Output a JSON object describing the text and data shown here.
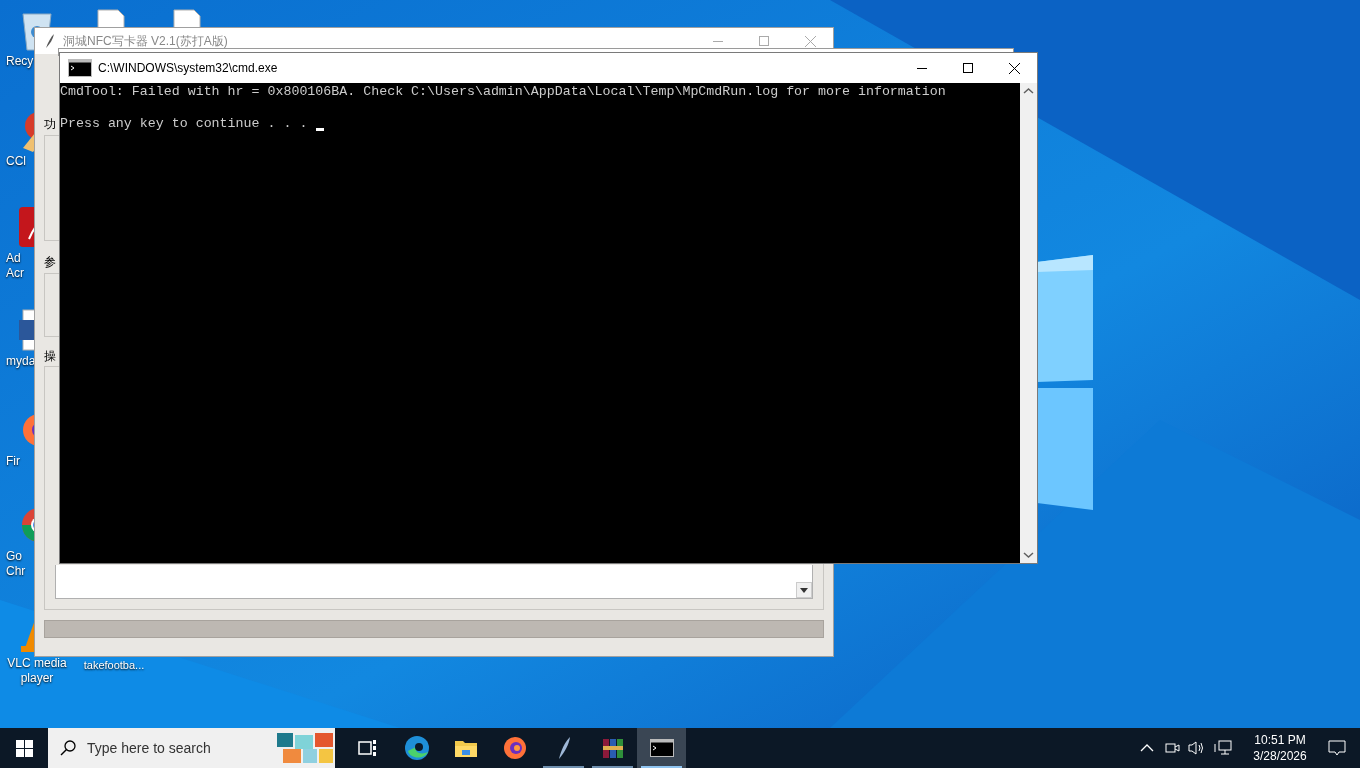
{
  "desktop_icons": [
    {
      "kind": "recycle",
      "lines": [
        "Recy"
      ]
    },
    {
      "kind": "ccleaner",
      "lines": [
        "CCl"
      ]
    },
    {
      "kind": "acrobat",
      "lines": [
        "Ad",
        "Acr"
      ]
    },
    {
      "kind": "word",
      "lines": [
        "myda"
      ]
    },
    {
      "kind": "firefox",
      "lines": [
        "Fir"
      ]
    },
    {
      "kind": "chrome",
      "lines": [
        "Go",
        "Chr"
      ]
    },
    {
      "kind": "vlc",
      "lines": [
        "VLC media",
        "player"
      ]
    },
    {
      "lines": [
        "takefootba..."
      ]
    }
  ],
  "background_window": {
    "title": "洞城NFC写卡器 V2.1(苏打A版)",
    "group_labels": [
      "功",
      "参",
      "操"
    ],
    "progress": {
      "level": 0
    }
  },
  "console": {
    "title": "C:\\WINDOWS\\system32\\cmd.exe",
    "error_line": "CmdTool: Failed with hr = 0x800106BA. Check C:\\Users\\admin\\AppData\\Local\\Temp\\MpCmdRun.log for more information",
    "prompt_line": "Press any key to continue . . ."
  },
  "taskbar": {
    "search": {
      "placeholder": "Type here to search"
    },
    "apps": [
      {
        "kind": "taskview",
        "running": false,
        "active": false
      },
      {
        "kind": "edge",
        "running": false,
        "active": false
      },
      {
        "kind": "explorer",
        "running": false,
        "active": false
      },
      {
        "kind": "firefox",
        "running": false,
        "active": false
      },
      {
        "kind": "feather",
        "running": true,
        "active": false
      },
      {
        "kind": "winrar",
        "running": true,
        "active": false
      },
      {
        "kind": "cmd",
        "running": true,
        "active": true
      }
    ],
    "time": "10:51 PM",
    "date": "3/28/2026"
  }
}
